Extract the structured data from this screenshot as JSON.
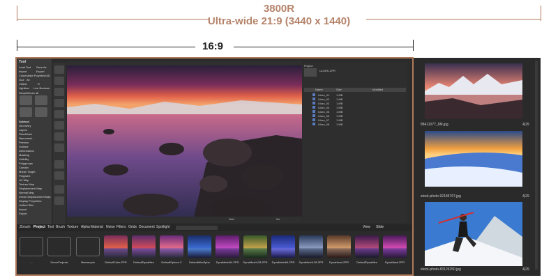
{
  "header": {
    "title": "3800R",
    "subtitle": "Ultra-wide 21:9 (3440 x 1440)",
    "aspect_label": "16:9"
  },
  "app": {
    "left_panel": {
      "title": "Tool",
      "top_rows": [
        "Load Tool",
        "Save As",
        "Import",
        "Export",
        "Clone",
        "Make PolyMesh3D",
        "GoZ",
        "All",
        "Visible",
        "R",
        "Lightbox",
        "Live Boolean"
      ],
      "size_label": "SimpleBrush 48",
      "menu_items": [
        "Subtool",
        "Geometry",
        "Layers",
        "FiberMesh",
        "Nanomesh",
        "Preview",
        "Surface",
        "Deformation",
        "Masking",
        "Visibility",
        "Polygroups",
        "Contact",
        "Morph Target",
        "Polypaint",
        "UV Map",
        "Texture Map",
        "Displacement Map",
        "Normal Map",
        "Vector Displacement Map",
        "Display Properties",
        "Unified Skin",
        "Import",
        "Export"
      ]
    },
    "right_panel": {
      "header": "Project",
      "file_label": "ULURU.ZPR",
      "columns": [
        "Name",
        "Size",
        "Modified"
      ],
      "rows": [
        {
          "name": "Uluru_01",
          "size": "1 MB"
        },
        {
          "name": "Uluru_02",
          "size": "1 MB"
        },
        {
          "name": "Uluru_03",
          "size": "1 MB"
        },
        {
          "name": "Uluru_04",
          "size": "1 MB"
        },
        {
          "name": "Uluru_05",
          "size": "1 MB"
        },
        {
          "name": "Uluru_06",
          "size": "1 MB"
        },
        {
          "name": "Uluru_07",
          "size": "1 MB"
        },
        {
          "name": "Uluru_08",
          "size": "1 MB"
        }
      ]
    },
    "viewport_footer": {
      "go": "Go",
      "grid": "Grid"
    },
    "tabs": [
      "Zbrush",
      "Project",
      "Tool",
      "Brush",
      "Texture",
      "Alpha",
      "Material",
      "Noise",
      "Filters",
      "Grids",
      "Document",
      "Spotlight"
    ],
    "tab_right": [
      "View",
      "Slide"
    ],
    "shelf": {
      "empty": [
        {
          "label": "..."
        },
        {
          "label": "DemoProjects"
        },
        {
          "label": "Mannequin"
        }
      ],
      "items": [
        {
          "label": "DefaultCube.ZPR"
        },
        {
          "label": "DefaultDynaMes"
        },
        {
          "label": "DefaultSphere.Z"
        },
        {
          "label": "DefaultWaxSphe"
        },
        {
          "label": "DynaMesh64.ZPR"
        },
        {
          "label": "DynaMesh128.ZPR"
        },
        {
          "label": "DynaMesh64.ZPR"
        },
        {
          "label": "DynaMesh128.ZPR"
        },
        {
          "label": "DynaHead.ZPR"
        },
        {
          "label": "DefaultDynaMes"
        },
        {
          "label": "DynaMask.ZPR"
        }
      ]
    }
  },
  "side_gallery": [
    {
      "filename": "88411077_6M.jpg",
      "count": "4|29"
    },
    {
      "filename": "stock-photo-92185767.jpg",
      "count": "4|29"
    },
    {
      "filename": "stock-photo-83126250.jpg",
      "count": "4|29"
    }
  ],
  "colors": {
    "accent": "#b5836a",
    "app_bg": "#2b2b2b",
    "panel_bg": "#3a3a3a"
  }
}
